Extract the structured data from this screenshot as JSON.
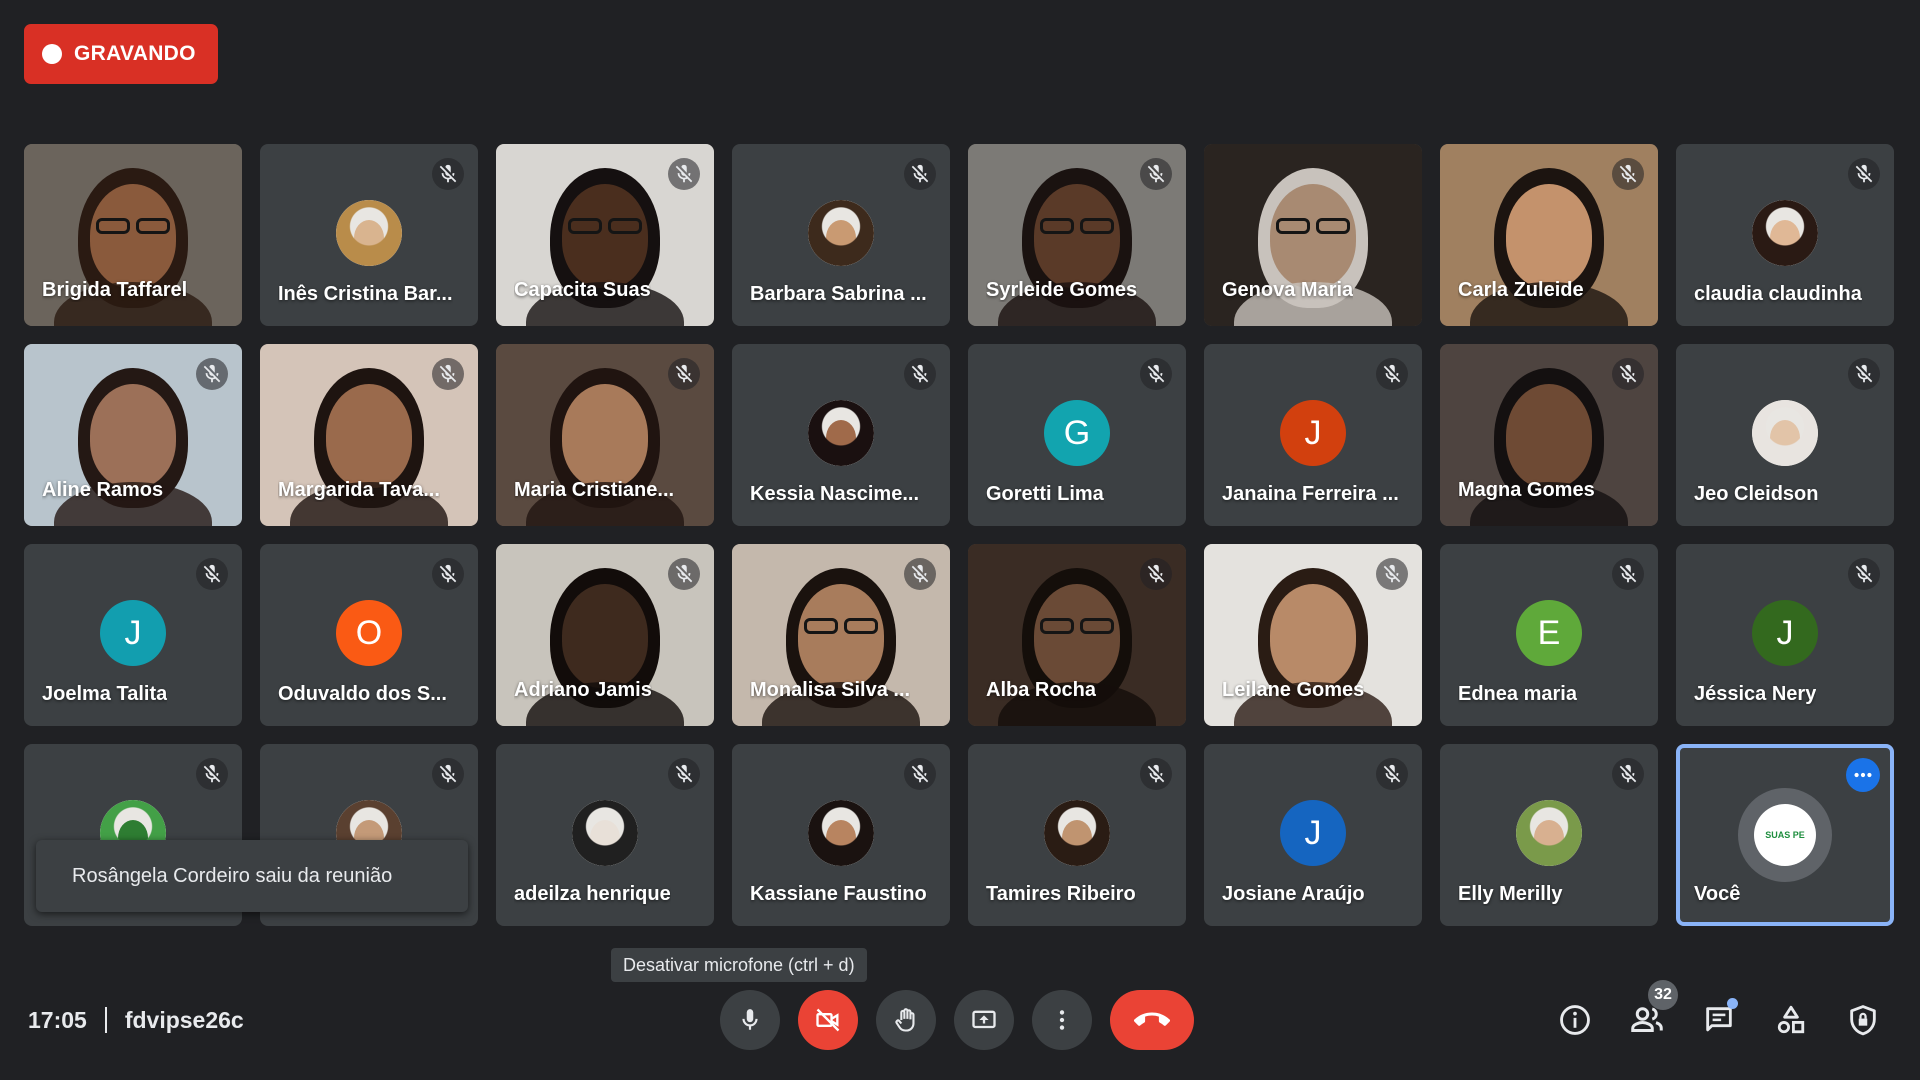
{
  "recording": {
    "label": "GRAVANDO"
  },
  "participants": [
    {
      "name": "Brigida Taffarel",
      "type": "video",
      "muted": false,
      "bg": "#6b645c",
      "skin": "#8a5a3c",
      "hair": "#2a1a12",
      "glasses": true
    },
    {
      "name": "Inês Cristina Bar...",
      "type": "photo",
      "muted": true,
      "skin": "#d9b48f",
      "hair": "#b98c4a"
    },
    {
      "name": "Capacita Suas",
      "type": "video",
      "muted": true,
      "bg": "#d8d6d2",
      "skin": "#4a2e1e",
      "hair": "#151010",
      "glasses": true
    },
    {
      "name": "Barbara Sabrina ...",
      "type": "photo",
      "muted": true,
      "skin": "#c99a72",
      "hair": "#3d2a1c"
    },
    {
      "name": "Syrleide Gomes",
      "type": "video",
      "muted": true,
      "bg": "#7c7a76",
      "skin": "#5a3a28",
      "hair": "#1a1210",
      "glasses": true
    },
    {
      "name": "Genova Maria",
      "type": "video",
      "muted": false,
      "bg": "#2a2420",
      "skin": "#a88a72",
      "hair": "#c8c2bc",
      "glasses": true
    },
    {
      "name": "Carla Zuleide",
      "type": "video",
      "muted": true,
      "bg": "#a08060",
      "skin": "#c4926c",
      "hair": "#1c1410",
      "glasses": false
    },
    {
      "name": "claudia claudinha",
      "type": "photo",
      "muted": true,
      "skin": "#e0b896",
      "hair": "#2a1a14"
    },
    {
      "name": "Aline Ramos",
      "type": "video",
      "muted": true,
      "bg": "#b8c4cc",
      "skin": "#9c7058",
      "hair": "#241814",
      "glasses": false
    },
    {
      "name": "Margarida Tava...",
      "type": "video",
      "muted": true,
      "bg": "#d4c4b8",
      "skin": "#9a6a4c",
      "hair": "#1e1410",
      "glasses": false
    },
    {
      "name": "Maria Cristiane...",
      "type": "video",
      "muted": true,
      "bg": "#5a4a40",
      "skin": "#a87a5a",
      "hair": "#201410",
      "glasses": false
    },
    {
      "name": "Kessia Nascime...",
      "type": "photo",
      "muted": true,
      "skin": "#a06a4a",
      "hair": "#1a1010"
    },
    {
      "name": "Goretti Lima",
      "type": "letter",
      "muted": true,
      "letter": "G",
      "color": "#12a4af"
    },
    {
      "name": "Janaina Ferreira ...",
      "type": "letter",
      "muted": true,
      "letter": "J",
      "color": "#d2400e"
    },
    {
      "name": "Magna Gomes",
      "type": "video",
      "muted": true,
      "bg": "#4e4440",
      "skin": "#6e4a34",
      "hair": "#141010",
      "glasses": false
    },
    {
      "name": "Jeo Cleidson",
      "type": "photo",
      "muted": true,
      "skin": "#e2c4a8",
      "hair": "#e8e4e0"
    },
    {
      "name": "Joelma Talita",
      "type": "letter",
      "muted": true,
      "letter": "J",
      "color": "#129eaf"
    },
    {
      "name": "Oduvaldo dos S...",
      "type": "letter",
      "muted": true,
      "letter": "O",
      "color": "#fa5a14"
    },
    {
      "name": "Adriano Jamis",
      "type": "video",
      "muted": true,
      "bg": "#c8c4bc",
      "skin": "#3e2a1e",
      "hair": "#120c0a",
      "glasses": false
    },
    {
      "name": "Monalisa Silva ...",
      "type": "video",
      "muted": true,
      "bg": "#c4b8ac",
      "skin": "#a87c5c",
      "hair": "#1a120e",
      "glasses": true
    },
    {
      "name": "Alba Rocha",
      "type": "video",
      "muted": true,
      "bg": "#3a2c24",
      "skin": "#6a4a36",
      "hair": "#140e0a",
      "glasses": true
    },
    {
      "name": "Leilane Gomes",
      "type": "video",
      "muted": true,
      "bg": "#e4e2de",
      "skin": "#b88a68",
      "hair": "#2a1c14",
      "glasses": false
    },
    {
      "name": "Ednea maria",
      "type": "letter",
      "muted": true,
      "letter": "E",
      "color": "#5fa93a"
    },
    {
      "name": "Jéssica Nery",
      "type": "letter",
      "muted": true,
      "letter": "J",
      "color": "#33691e"
    },
    {
      "name": "",
      "type": "photo",
      "muted": true,
      "skin": "#2e7d32",
      "hair": "#43a047"
    },
    {
      "name": "",
      "type": "photo",
      "muted": true,
      "skin": "#c49a78",
      "hair": "#5a4030"
    },
    {
      "name": "adeilza henrique",
      "type": "photo",
      "muted": true,
      "skin": "#e8e0d8",
      "hair": "#202020"
    },
    {
      "name": "Kassiane Faustino",
      "type": "photo",
      "muted": true,
      "skin": "#b88460",
      "hair": "#1a1210"
    },
    {
      "name": "Tamires Ribeiro",
      "type": "photo",
      "muted": true,
      "skin": "#c09470",
      "hair": "#2a1c14"
    },
    {
      "name": "Josiane Araújo",
      "type": "letter",
      "muted": true,
      "letter": "J",
      "color": "#1565c0"
    },
    {
      "name": "Elly Merilly",
      "type": "photo",
      "muted": true,
      "skin": "#d8b090",
      "hair": "#7a9a4a"
    },
    {
      "name": "Você",
      "type": "self",
      "muted": false,
      "logo_text": "SUAS PE"
    }
  ],
  "toast": {
    "message": "Rosângela Cordeiro saiu da reunião"
  },
  "tooltip": {
    "text": "Desativar microfone (ctrl + d)"
  },
  "meeting": {
    "time": "17:05",
    "code": "fdvipse26c"
  },
  "controls": [
    {
      "icon": "mic-icon",
      "variant": "normal"
    },
    {
      "icon": "camera-off-icon",
      "variant": "red"
    },
    {
      "icon": "raise-hand-icon",
      "variant": "normal"
    },
    {
      "icon": "present-screen-icon",
      "variant": "normal"
    },
    {
      "icon": "more-options-icon",
      "variant": "normal"
    },
    {
      "icon": "hang-up-icon",
      "variant": "hangup"
    }
  ],
  "right_panel": {
    "participant_count": "32"
  },
  "colors": {
    "background": "#202124",
    "tile": "#3c4043",
    "recording": "#d93025",
    "accent": "#8ab4f8",
    "hangup": "#ea4335"
  }
}
